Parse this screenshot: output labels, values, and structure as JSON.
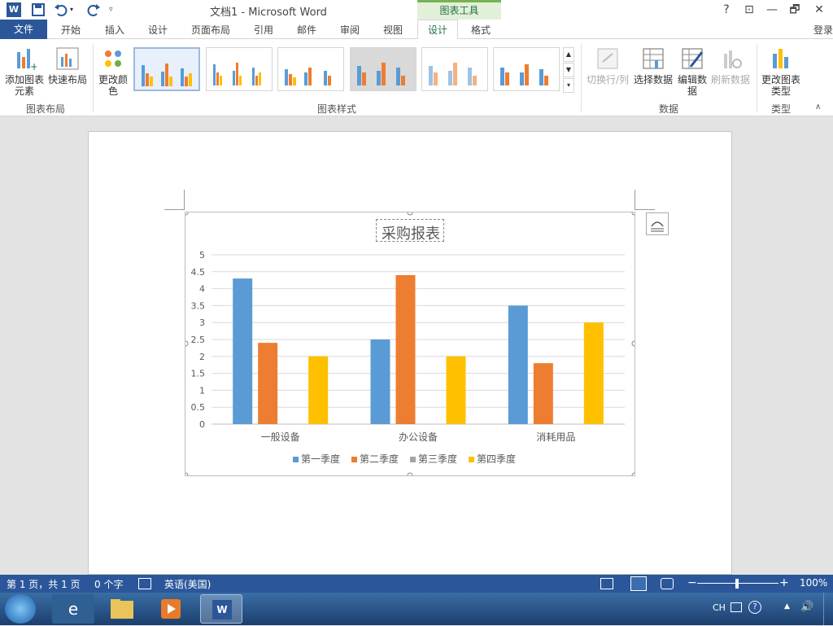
{
  "titlebar": {
    "title": "文档1 - Microsoft Word",
    "tools_label": "图表工具",
    "help": "?",
    "restore_ribbon": "⊡",
    "minimize": "—",
    "maximize": "🗗",
    "close": "✕"
  },
  "tabs": {
    "file": "文件",
    "home": "开始",
    "insert": "插入",
    "design": "设计",
    "layout": "页面布局",
    "references": "引用",
    "mailings": "邮件",
    "review": "审阅",
    "view": "视图",
    "chart_design": "设计",
    "chart_format": "格式",
    "login": "登录"
  },
  "ribbon": {
    "add_element": "添加图表元素",
    "quick_layout": "快速布局",
    "group_layout": "图表布局",
    "change_colors": "更改颜色",
    "group_styles": "图表样式",
    "switch_rowcol": "切换行/列",
    "select_data": "选择数据",
    "edit_data": "编辑数据",
    "refresh_data": "刷新数据",
    "group_data": "数据",
    "change_type": "更改图表类型",
    "group_type": "类型"
  },
  "chart_data": {
    "type": "bar",
    "title": "采购报表",
    "categories": [
      "一般设备",
      "办公设备",
      "消耗用品"
    ],
    "series": [
      {
        "name": "第一季度",
        "values": [
          4.3,
          2.5,
          3.5
        ],
        "color": "#5b9bd5"
      },
      {
        "name": "第二季度",
        "values": [
          2.4,
          4.4,
          1.8
        ],
        "color": "#ed7d31"
      },
      {
        "name": "第三季度",
        "values": [
          0,
          0,
          0
        ],
        "color": "#a5a5a5"
      },
      {
        "name": "第四季度",
        "values": [
          2,
          2,
          3
        ],
        "color": "#ffc000"
      }
    ],
    "yticks": [
      "0",
      "0.5",
      "1",
      "1.5",
      "2",
      "2.5",
      "3",
      "3.5",
      "4",
      "4.5",
      "5"
    ],
    "ylim": [
      0,
      5
    ],
    "grid": true,
    "legend": "bottom"
  },
  "status": {
    "page": "第 1 页，共 1 页",
    "words": "0 个字",
    "lang": "英语(美国)",
    "zoom": "100%"
  },
  "tray": {
    "lang": "CH"
  }
}
